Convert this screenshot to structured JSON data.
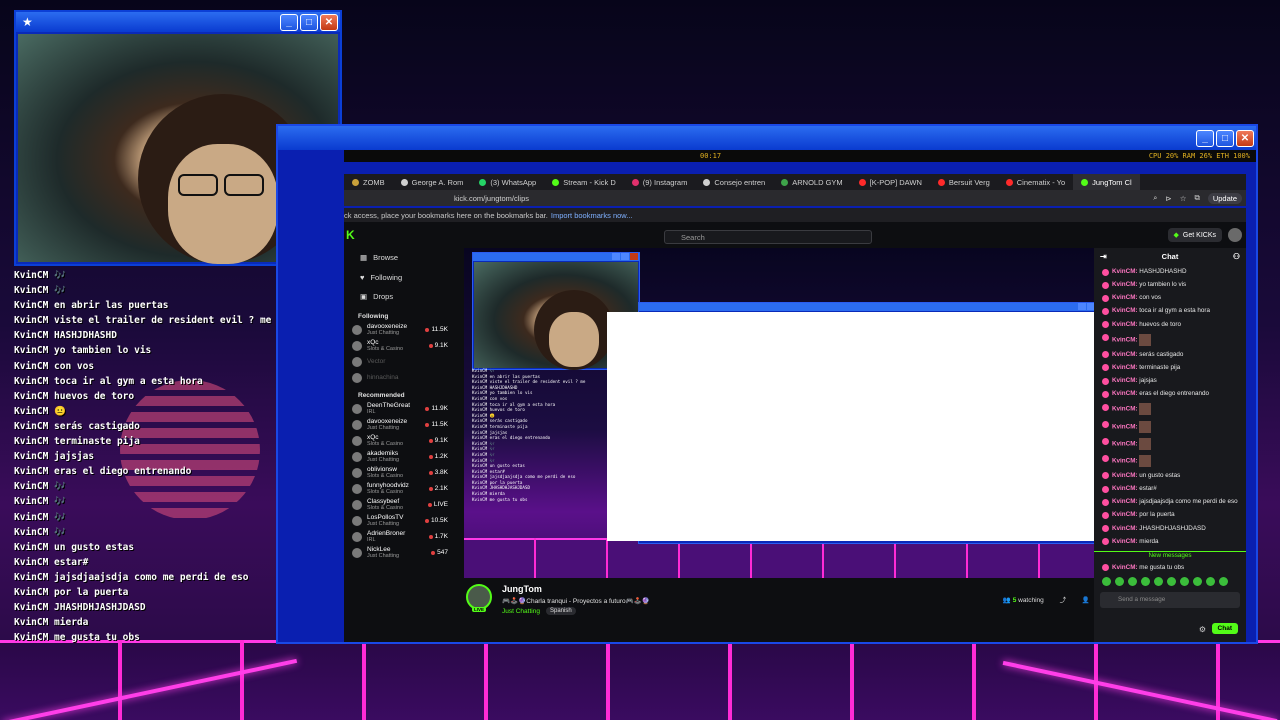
{
  "overlay_chat": {
    "lines": [
      "KvinCM 🎶",
      "KvinCM 🎶",
      "KvinCM en abrir las puertas",
      "KvinCM viste el trailer de resident evil ? me",
      "KvinCM HASHJDHASHD",
      "KvinCM yo tambien lo vis",
      "KvinCM con vos",
      "KvinCM toca ir al gym a esta hora",
      "KvinCM huevos de toro",
      "KvinCM 😐",
      "KvinCM serás castigado",
      "KvinCM terminaste pija",
      "KvinCM jajsjas",
      "KvinCM eras el diego entrenando",
      "KvinCM 🎶",
      "KvinCM 🎶",
      "KvinCM 🎶",
      "KvinCM 🎶",
      "KvinCM un gusto estas",
      "KvinCM estar#",
      "KvinCM jajsdjaajsdja como me perdi de eso",
      "KvinCM por la puerta",
      "KvinCM JHASHDHJASHJDASD",
      "KvinCM mierda",
      "KvinCM me gusta tu obs"
    ]
  },
  "system": {
    "clock": "00:17",
    "stats": "CPU 20%   RAM 26%   ETH   100%"
  },
  "browser": {
    "tabs": [
      {
        "label": "ZOMB",
        "color": "#c9a13a"
      },
      {
        "label": "George A. Rom",
        "color": "#d0d0d0"
      },
      {
        "label": "(3) WhatsApp",
        "color": "#25d366"
      },
      {
        "label": "Stream - Kick D",
        "color": "#53fc18"
      },
      {
        "label": "(9) Instagram",
        "color": "#e1306c"
      },
      {
        "label": "Consejo entren",
        "color": "#d0d0d0"
      },
      {
        "label": "ARNOLD GYM",
        "color": "#3ea44a"
      },
      {
        "label": "[K-POP] DAWN",
        "color": "#ff2a2a"
      },
      {
        "label": "Bersuit Verg",
        "color": "#ff2a2a"
      },
      {
        "label": "Cinematix - Yo",
        "color": "#ff2a2a"
      },
      {
        "label": "JungTom Cl",
        "color": "#53fc18",
        "active": true
      }
    ],
    "url": "kick.com/jungtom/clips",
    "update_label": "Update",
    "bookmarks_text": "ck access, place your bookmarks here on the bookmarks bar.",
    "bookmarks_link": "Import bookmarks now..."
  },
  "kick": {
    "search_placeholder": "Search",
    "get_kicks": "Get KICKs",
    "nav": [
      {
        "label": "Browse",
        "icon": "browse-icon"
      },
      {
        "label": "Following",
        "icon": "heart-icon"
      },
      {
        "label": "Drops",
        "icon": "drops-icon"
      }
    ],
    "following_title": "Following",
    "recommended_title": "Recommended",
    "following": [
      {
        "name": "davooxeneize",
        "cat": "Just Chatting",
        "viewers": "11.5K",
        "live": true
      },
      {
        "name": "xQc",
        "cat": "Slots & Casino",
        "viewers": "9.1K",
        "live": true
      },
      {
        "name": "Vector",
        "cat": "",
        "viewers": "",
        "live": false
      },
      {
        "name": "hinnachina",
        "cat": "",
        "viewers": "",
        "live": false
      }
    ],
    "recommended": [
      {
        "name": "DeenTheGreat",
        "cat": "IRL",
        "viewers": "11.9K"
      },
      {
        "name": "davooxeneize",
        "cat": "Just Chatting",
        "viewers": "11.5K"
      },
      {
        "name": "xQc",
        "cat": "Slots & Casino",
        "viewers": "9.1K"
      },
      {
        "name": "akademiks",
        "cat": "Just Chatting",
        "viewers": "1.2K"
      },
      {
        "name": "oblivionsw",
        "cat": "Slots & Casino",
        "viewers": "3.8K"
      },
      {
        "name": "funnyhoodvidz",
        "cat": "Slots & Casino",
        "viewers": "2.1K"
      },
      {
        "name": "Classybeef",
        "cat": "Slots & Casino",
        "viewers": "LIVE"
      },
      {
        "name": "LosPollosTV",
        "cat": "Just Chatting",
        "viewers": "10.5K"
      },
      {
        "name": "AdrienBroner",
        "cat": "IRL",
        "viewers": "1.7K"
      },
      {
        "name": "NickLee",
        "cat": "Just Chatting",
        "viewers": "547"
      }
    ],
    "stream": {
      "streamer": "JungTom",
      "title": "🎮🕹️🔮Charla tranqui - Proyectos a futuro🎮🕹️🔮",
      "category": "Just Chatting",
      "language": "Spanish",
      "watching_count": "5",
      "watching_label": "watching",
      "live_label": "LIVE"
    },
    "chat": {
      "title": "Chat",
      "messages": [
        {
          "user": "KvinCM:",
          "text": "HASHJDHASHD"
        },
        {
          "user": "KvinCM:",
          "text": "yo tambien lo vis"
        },
        {
          "user": "KvinCM:",
          "text": "con vos"
        },
        {
          "user": "KvinCM:",
          "text": "toca ir al gym a esta hora"
        },
        {
          "user": "KvinCM:",
          "text": "huevos de toro"
        },
        {
          "user": "KvinCM:",
          "text": "",
          "emote": true
        },
        {
          "user": "KvinCM:",
          "text": "serás castigado"
        },
        {
          "user": "KvinCM:",
          "text": "terminaste pija"
        },
        {
          "user": "KvinCM:",
          "text": "jajsjas"
        },
        {
          "user": "KvinCM:",
          "text": "eras el diego entrenando"
        },
        {
          "user": "KvinCM:",
          "text": "",
          "emote": true
        },
        {
          "user": "KvinCM:",
          "text": "",
          "emote": true
        },
        {
          "user": "KvinCM:",
          "text": "",
          "emote": true
        },
        {
          "user": "KvinCM:",
          "text": "",
          "emote": true
        },
        {
          "user": "KvinCM:",
          "text": "un gusto estas"
        },
        {
          "user": "KvinCM:",
          "text": "estar#"
        },
        {
          "user": "KvinCM:",
          "text": "jajsdjaajsdja como me perdi de eso"
        },
        {
          "user": "KvinCM:",
          "text": "por la puerta"
        },
        {
          "user": "KvinCM:",
          "text": "JHASHDHJASHJDASD"
        },
        {
          "user": "KvinCM:",
          "text": "mierda"
        }
      ],
      "new_messages": "New messages",
      "last_message": {
        "user": "KvinCM:",
        "text": "me gusta tu obs"
      },
      "placeholder": "Send a message",
      "send_label": "Chat"
    }
  },
  "mini_chat_lines": [
    "KvinCM 🎶",
    "KvinCM en abrir las puertas",
    "KvinCM viste el trailer de resident evil ? me",
    "KvinCM HASHJDHASHD",
    "KvinCM yo tambien lo vis",
    "KvinCM con vos",
    "KvinCM toca ir al gym a esta hora",
    "KvinCM huevos de toro",
    "KvinCM 😐",
    "KvinCM serás castigado",
    "KvinCM terminaste pija",
    "KvinCM jajsjas",
    "KvinCM eras el diego entrenando",
    "KvinCM 🎶",
    "KvinCM 🎶",
    "KvinCM 🎶",
    "KvinCM 🎶",
    "KvinCM un gusto estas",
    "KvinCM estar#",
    "KvinCM jajsdjaajsdja como me perdi de eso",
    "KvinCM por la puerta",
    "KvinCM JHASHDHJASHJDASD",
    "KvinCM mierda",
    "KvinCM me gusta tu obs"
  ]
}
